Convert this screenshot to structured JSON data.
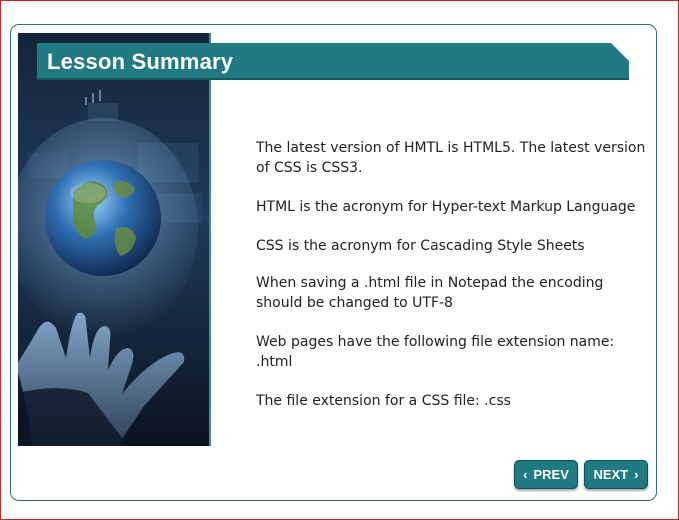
{
  "title": "Lesson Summary",
  "summary_items": [
    "The latest version of HMTL is HTML5. The latest version of CSS is CSS3.",
    "HTML is the acronym for Hyper-text Markup Language",
    "CSS is the acronym for Cascading Style Sheets",
    "When saving a .html file in Notepad the encoding should be changed to UTF-8",
    "Web pages have the following file extension name: .html",
    "The file extension for a CSS file: .css"
  ],
  "buttons": {
    "prev": {
      "label": "PREV",
      "icon": "chevron-left-icon",
      "glyph": "‹"
    },
    "next": {
      "label": "NEXT",
      "icon": "chevron-right-icon",
      "glyph": "›"
    }
  },
  "colors": {
    "banner": "#1f7a82",
    "button": "#1f7a82",
    "frame": "#2f6f80"
  }
}
